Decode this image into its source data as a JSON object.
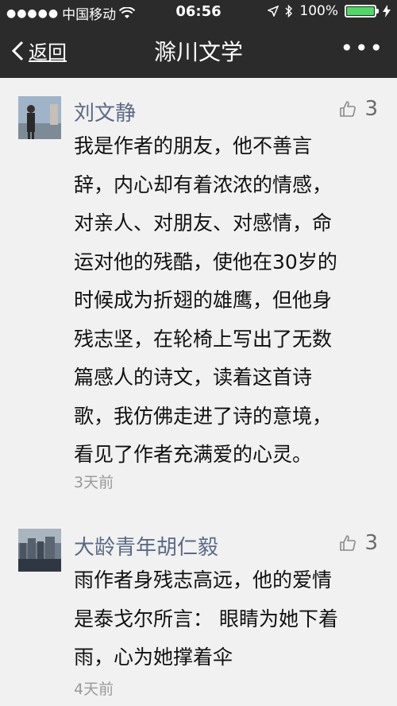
{
  "status_bar": {
    "carrier": "中国移动",
    "time": "06:56",
    "battery": "100%",
    "battery_level": 1.0
  },
  "nav": {
    "back_label": "返回",
    "title": "滁川文学",
    "more_icon": "more-dots-icon"
  },
  "comments": [
    {
      "author": "刘文静",
      "likes": "3",
      "lines": [
        "我是作者的朋友，他不善言",
        "辞，内心却有着浓浓的情感，",
        "对亲人、对朋友、对感情，命",
        "运对他的残酷，使他在30岁的",
        "时候成为折翅的雄鹰，但他身",
        "残志坚，在轮椅上写出了无数",
        "篇感人的诗文，读着这首诗",
        "歌，我仿佛走进了诗的意境，",
        "看见了作者充满爱的心灵。"
      ],
      "time": "3天前"
    },
    {
      "author": "大龄青年胡仁毅",
      "likes": "3",
      "lines": [
        "雨作者身残志高远，他的爱情",
        "是泰戈尔所言：  眼睛为她下着",
        "雨，心为她撑着伞"
      ],
      "time": "4天前"
    }
  ],
  "colors": {
    "header_bg": "#2b2b2b",
    "page_bg": "#f1f1f1",
    "author": "#5a6a84",
    "battery_green": "#4cd964"
  }
}
